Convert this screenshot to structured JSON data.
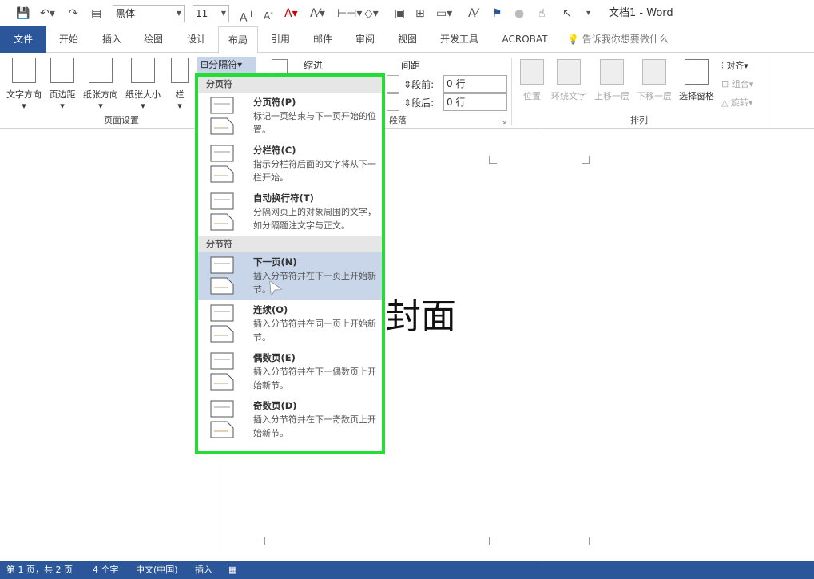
{
  "title": "文档1 - Word",
  "quick_access": {
    "font": "黑体",
    "size": "11"
  },
  "tabs": [
    "文件",
    "开始",
    "插入",
    "绘图",
    "设计",
    "布局",
    "引用",
    "邮件",
    "审阅",
    "视图",
    "开发工具",
    "ACROBAT"
  ],
  "active_tab": "布局",
  "tell_me": "告诉我你想要做什么",
  "ribbon": {
    "page_setup": {
      "label": "页面设置",
      "buttons": [
        "文字方向",
        "页边距",
        "纸张方向",
        "纸张大小",
        "栏"
      ]
    },
    "breaks_button": "分隔符",
    "indent_label": "缩进",
    "spacing_label": "间距",
    "before_label": "段前:",
    "before_value": "0 行",
    "after_label": "段后:",
    "after_value": "0 行",
    "paragraph_label": "段落",
    "arrange": {
      "label": "排列",
      "buttons": [
        "位置",
        "环绕文字",
        "上移一层",
        "下移一层",
        "选择窗格"
      ],
      "small": [
        "对齐",
        "组合",
        "旋转"
      ]
    }
  },
  "menu": {
    "sections": [
      {
        "header": "分页符",
        "items": [
          {
            "title": "分页符(P)",
            "desc": "标记一页结束与下一页开始的位置。"
          },
          {
            "title": "分栏符(C)",
            "desc": "指示分栏符后面的文字将从下一栏开始。"
          },
          {
            "title": "自动换行符(T)",
            "desc": "分隔网页上的对象周围的文字，如分隔题注文字与正文。"
          }
        ]
      },
      {
        "header": "分节符",
        "items": [
          {
            "title": "下一页(N)",
            "desc": "插入分节符并在下一页上开始新节。"
          },
          {
            "title": "连续(O)",
            "desc": "插入分节符并在同一页上开始新节。"
          },
          {
            "title": "偶数页(E)",
            "desc": "插入分节符并在下一偶数页上开始新节。"
          },
          {
            "title": "奇数页(D)",
            "desc": "插入分节符并在下一奇数页上开始新节。"
          }
        ]
      }
    ],
    "highlighted": "下一页(N)",
    "border_color": "#22dd33"
  },
  "document": {
    "cover_text": "封面"
  },
  "status": {
    "page": "第 1 页，共 2 页",
    "words": "4 个字",
    "lang": "中文(中国)",
    "mode": "插入"
  },
  "colors": {
    "brand": "#2b579a"
  }
}
